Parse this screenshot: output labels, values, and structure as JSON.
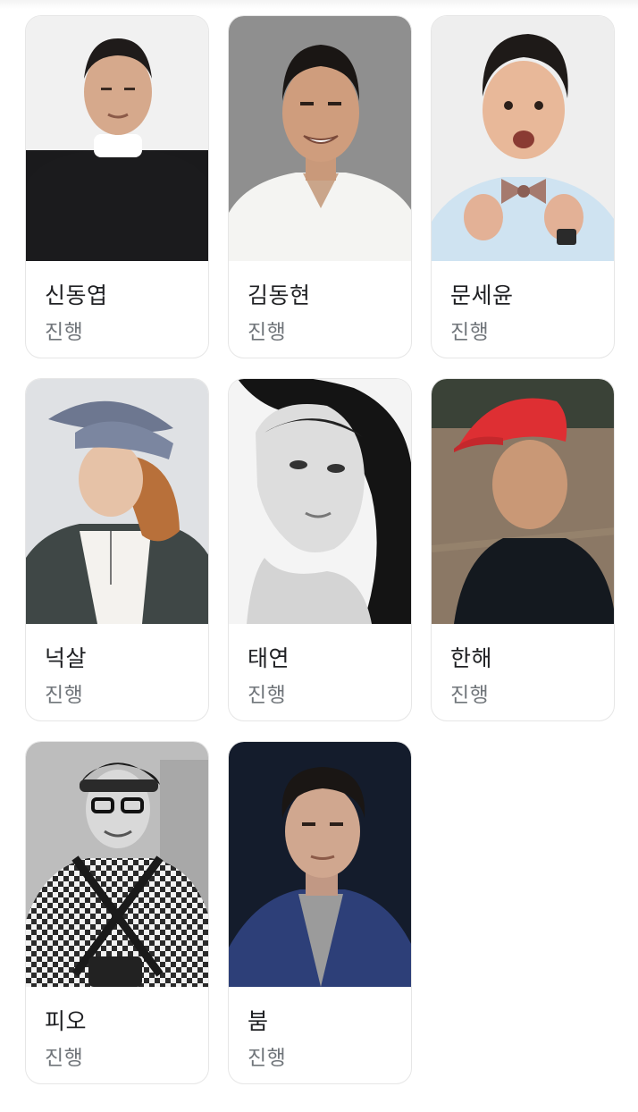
{
  "people": [
    {
      "name": "신동엽",
      "role": "진행",
      "photo": "man-black-sweater"
    },
    {
      "name": "김동현",
      "role": "진행",
      "photo": "man-white-shirt"
    },
    {
      "name": "문세윤",
      "role": "진행",
      "photo": "man-bowtie"
    },
    {
      "name": "넉살",
      "role": "진행",
      "photo": "man-bucket-hat"
    },
    {
      "name": "태연",
      "role": "진행",
      "photo": "woman-bw-portrait"
    },
    {
      "name": "한해",
      "role": "진행",
      "photo": "man-red-cap"
    },
    {
      "name": "피오",
      "role": "진행",
      "photo": "man-checked-shirt-glasses"
    },
    {
      "name": "붐",
      "role": "진행",
      "photo": "man-navy-jacket"
    }
  ]
}
